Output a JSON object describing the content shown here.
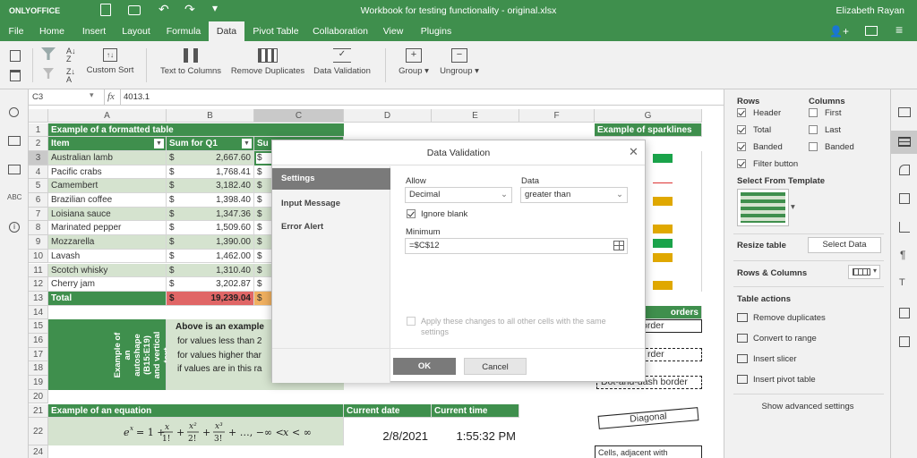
{
  "titlebar": {
    "logo": "ONLYOFFICE",
    "title": "Workbook for testing functionality - original.xlsx",
    "user": "Elizabeth Rayan"
  },
  "menu": {
    "tabs": [
      "File",
      "Home",
      "Insert",
      "Layout",
      "Formula",
      "Data",
      "Pivot Table",
      "Collaboration",
      "View",
      "Plugins"
    ],
    "active": "Data"
  },
  "toolbar": {
    "custom_sort": "Custom Sort",
    "text_to_columns": "Text to Columns",
    "remove_duplicates": "Remove Duplicates",
    "data_validation": "Data Validation",
    "group": "Group",
    "ungroup": "Ungroup"
  },
  "formula_bar": {
    "cell_ref": "C3",
    "fx": "fx",
    "value": "4013.1"
  },
  "columns": [
    "A",
    "B",
    "C",
    "D",
    "E",
    "F",
    "G"
  ],
  "rows": [
    "1",
    "2",
    "3",
    "4",
    "5",
    "6",
    "7",
    "8",
    "9",
    "10",
    "11",
    "12",
    "13",
    "14",
    "15",
    "16",
    "17",
    "18",
    "19",
    "20",
    "21",
    "22",
    "23",
    "24"
  ],
  "sheet": {
    "title_formatted": "Example of a formatted table",
    "header_item": "Item",
    "header_sum": "Sum for Q1",
    "header_c": "Su",
    "items": [
      "Australian lamb",
      "Pacific crabs",
      "Camembert",
      "Brazilian coffee",
      "Loisiana sauce",
      "Marinated pepper",
      "Mozzarella",
      "Lavash",
      "Scotch whisky",
      "Cherry jam"
    ],
    "values": [
      "2,667.60",
      "1,768.41",
      "3,182.40",
      "1,398.40",
      "1,347.36",
      "1,509.60",
      "1,390.00",
      "1,462.00",
      "1,310.40",
      "3,202.87"
    ],
    "currency": "$",
    "total_label": "Total",
    "total_value": "19,239.04",
    "sparklines_title": "Example of sparklines",
    "autoshape_text": "Example of an autoshape (B15:E19) and vertical text",
    "above_example": "Above is an example",
    "line_16": "for values less than 2",
    "line_17": "for values higher thar",
    "line_18": "if values are in this ra",
    "borders_title": "orders",
    "border_16": "order",
    "border_18": "rder",
    "border_20": "Dot-and-dash border",
    "equation_title": "Example of an equation",
    "current_date_label": "Current date",
    "current_time_label": "Current time",
    "current_date": "2/8/2021",
    "current_time": "1:55:32 PM",
    "diagonal": "Diagonal",
    "cells_adjacent": "Cells, adjacent with"
  },
  "dialog": {
    "title": "Data Validation",
    "tabs": [
      "Settings",
      "Input Message",
      "Error Alert"
    ],
    "allow_label": "Allow",
    "allow_value": "Decimal",
    "data_label": "Data",
    "data_value": "greater than",
    "ignore_blank": "Ignore blank",
    "minimum_label": "Minimum",
    "minimum_value": "=$C$12",
    "apply_text_1": "Apply these changes to all other cells with the same",
    "apply_text_2": "settings",
    "ok": "OK",
    "cancel": "Cancel"
  },
  "right_panel": {
    "rows_label": "Rows",
    "columns_label": "Columns",
    "header": "Header",
    "total": "Total",
    "banded_rows": "Banded",
    "filter_button": "Filter button",
    "first": "First",
    "last": "Last",
    "banded_cols": "Banded",
    "select_from_template": "Select From Template",
    "resize_table": "Resize table",
    "select_data": "Select Data",
    "rows_columns": "Rows & Columns",
    "table_actions": "Table actions",
    "remove_duplicates": "Remove duplicates",
    "convert_to_range": "Convert to range",
    "insert_slicer": "Insert slicer",
    "insert_pivot_table": "Insert pivot table",
    "show_advanced": "Show advanced settings"
  },
  "colors": {
    "accent": "#3f8f4d",
    "light_green": "#d5e3cf",
    "total_red": "#e06666",
    "bar_green": "#1aa34a",
    "bar_yellow": "#e0a800"
  }
}
